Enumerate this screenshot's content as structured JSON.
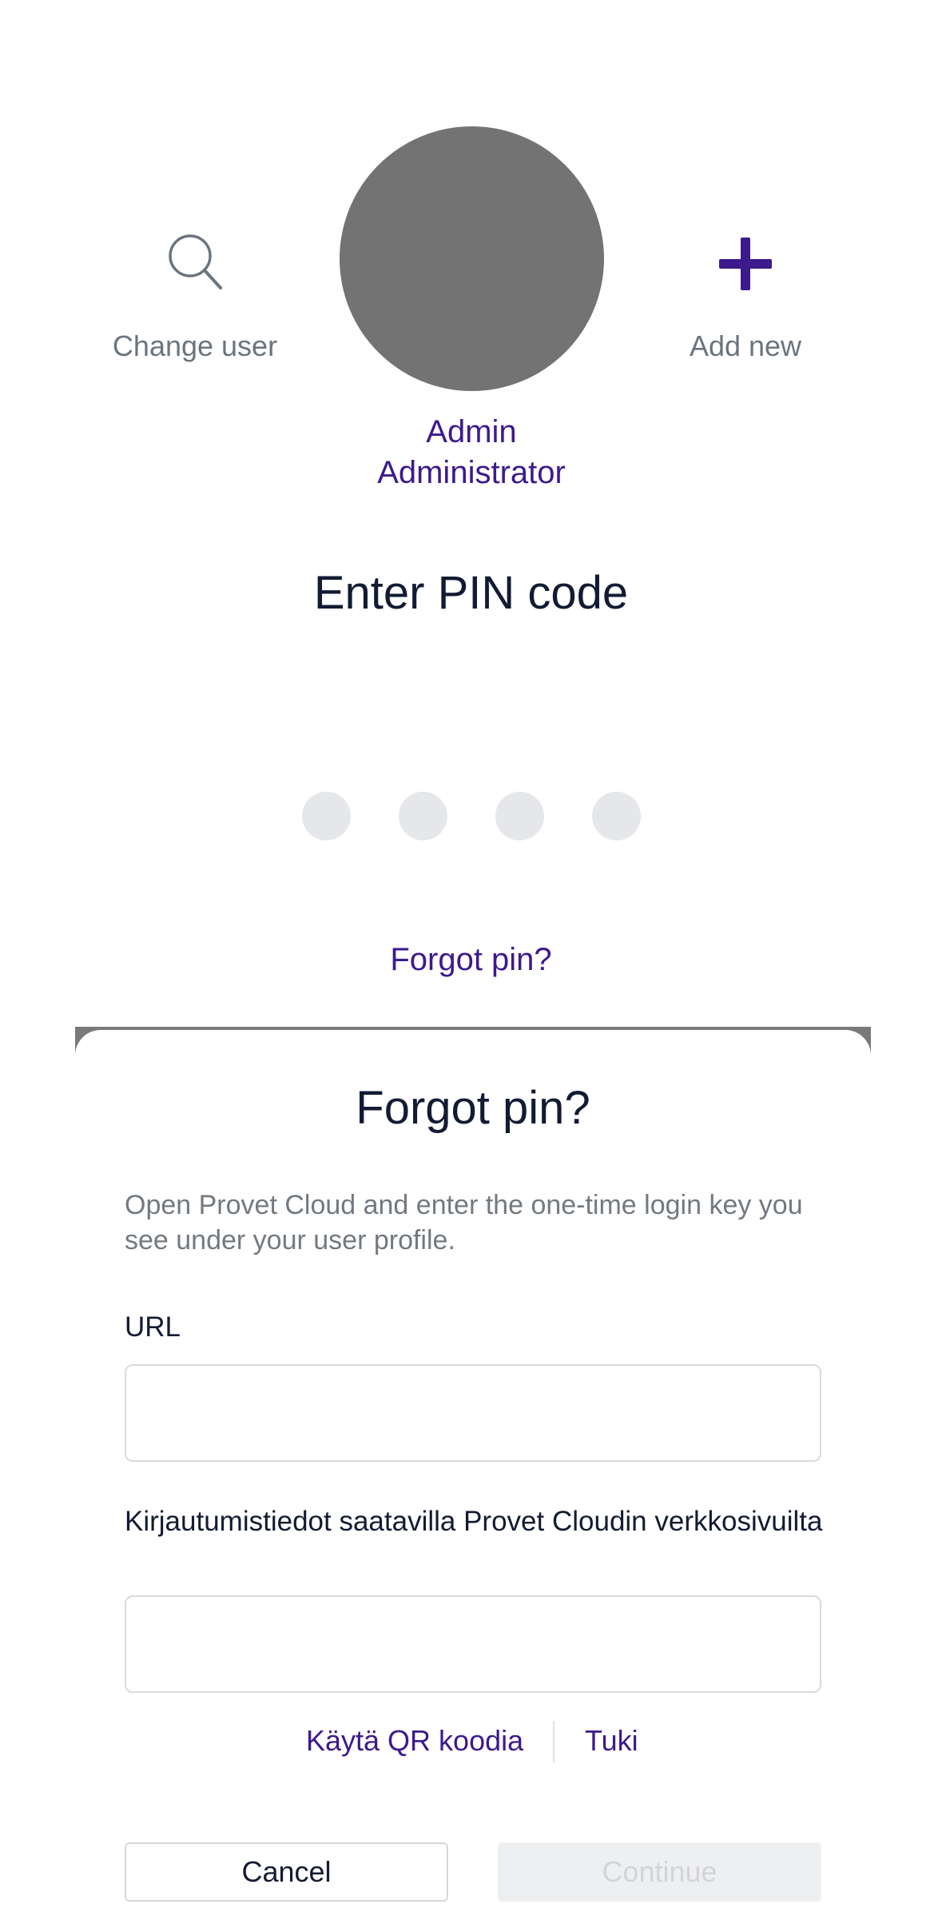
{
  "user_switcher": {
    "change_user_label": "Change user",
    "change_user_icon": "search-icon",
    "add_new_label": "Add new",
    "add_new_icon": "plus-icon",
    "current_user": {
      "first_name": "Admin",
      "last_name": "Administrator"
    }
  },
  "pin": {
    "title": "Enter PIN code",
    "digits_total": 4,
    "digits_entered": 0,
    "forgot_link": "Forgot pin?"
  },
  "forgot_sheet": {
    "title": "Forgot pin?",
    "description": "Open Provet Cloud and enter the one-time login key you see under your user profile.",
    "url_label": "URL",
    "url_value": "",
    "login_info_label": "Kirjautumistiedot saatavilla Provet Cloudin verkkosivuilta",
    "login_info_value": "",
    "qr_link": "Käytä QR koodia",
    "support_link": "Tuki",
    "cancel_label": "Cancel",
    "continue_label": "Continue",
    "continue_enabled": false
  },
  "colors": {
    "accent": "#3d1a8c",
    "text_dark": "#121b33",
    "text_muted": "#6b7580",
    "avatar": "#737373",
    "pin_dot_empty": "#e6e7eb"
  }
}
